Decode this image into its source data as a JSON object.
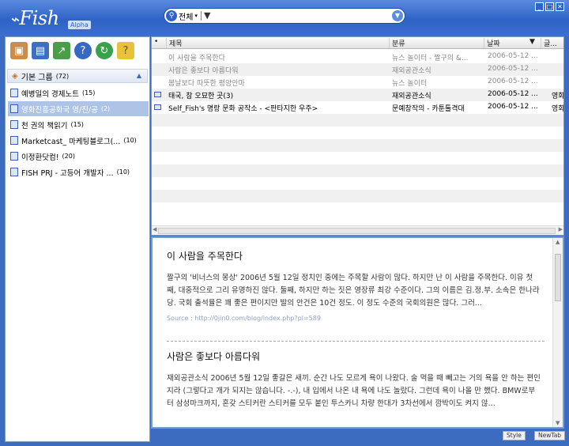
{
  "app": {
    "logo": "Fish",
    "badge": "Alpha"
  },
  "search": {
    "scope": "전체",
    "query": "",
    "placeholder": ""
  },
  "window_controls": [
    "_",
    "□",
    "✕"
  ],
  "toolbar": [
    "add-feed",
    "add-group",
    "import",
    "help",
    "refresh",
    "notes"
  ],
  "group": {
    "name": "기본 그룹",
    "count": "(72)"
  },
  "feeds": [
    {
      "name": "예병일의 경제노트",
      "count": "(15)",
      "selected": false
    },
    {
      "name": "영화진흥공화국 영/진/공",
      "count": "(2)",
      "selected": true
    },
    {
      "name": "천 권의 책읽기",
      "count": "(15)",
      "selected": false
    },
    {
      "name": "Marketcast_ 마케팅블로그(...",
      "count": "(10)",
      "selected": false
    },
    {
      "name": "이정환닷컴!",
      "count": "(20)",
      "selected": false
    },
    {
      "name": "FISH PRJ - 고등어 개발자 ...",
      "count": "(10)",
      "selected": false
    }
  ],
  "list": {
    "columns": {
      "mark": "•",
      "title": "제목",
      "category": "분류",
      "date": "날짜",
      "sort": "▼",
      "extra": "글..."
    },
    "rows": [
      {
        "title": "이 사람을 주목한다",
        "category": "뉴스 놀이터 - 짤구의 &...",
        "date": "2006-05-12 ...",
        "extra": "",
        "read": true
      },
      {
        "title": "사람은 좋보다 아름다워",
        "category": "재외공관소식",
        "date": "2006-05-12 ...",
        "extra": "",
        "read": true
      },
      {
        "title": "봄날보다 따뜻한 평양안마",
        "category": "뉴스 놀이터",
        "date": "2006-05-12 ...",
        "extra": "",
        "read": true
      },
      {
        "title": "태국, 참 오묘한 곳(3)",
        "category": "재외공관소식",
        "date": "2006-05-12 ...",
        "extra": "영화",
        "read": false
      },
      {
        "title": "Self_Fish's 명랑 문화 공작소 - <판타지한 우주>",
        "category": "문예창작의 - 카툰툴격대",
        "date": "2006-05-12 ...",
        "extra": "영화",
        "read": false
      }
    ]
  },
  "preview": {
    "articles": [
      {
        "title": "이 사람을 주목한다",
        "body": "짤구의 '비너스의 몽상' 2006년 5월 12일 정치인 중에는 주목할 사람이 많다. 하지만 난 이 사람을 주목한다. 이유 첫째, 대중적으로 그리 유명하진 않다. 둘째, 하지만 하는 짓은 영장류 최강 수준이다. 그의 이름은 김.정.부. 소속은 한나라당. 국회 출석율은 꽤 좋은 편이지만 발의 안건은 10건 정도. 이 정도 수준의 국회의원은 많다. 그러...",
        "source": "Source : http://0jin0.com/blog/index.php?pl=589"
      },
      {
        "title": "사람은 좋보다 아름다워",
        "body": "재외공관소식 2006년 5월 12일 좋갈은 새끼. 순간 나도 모르게 욕이 나왔다. 술 먹을 때 빼고는 거의 욕을 안 하는 편인지라 (그렇다고 개가 되지는 않습니다. -.-), 내 입에서 나온 내 욕에 나도 놀랐다. 그런데 욕이 나올 만 했다. BMW로부터 삼성마크까지, 혼갖 스티커란 스티커를 모두 붙인 투스카니 차량 한대가 3차선에서 깜박이도 켜지 않..."
      }
    ]
  },
  "bottom": {
    "style_button": "Style",
    "newtab_button": "NewTab"
  }
}
